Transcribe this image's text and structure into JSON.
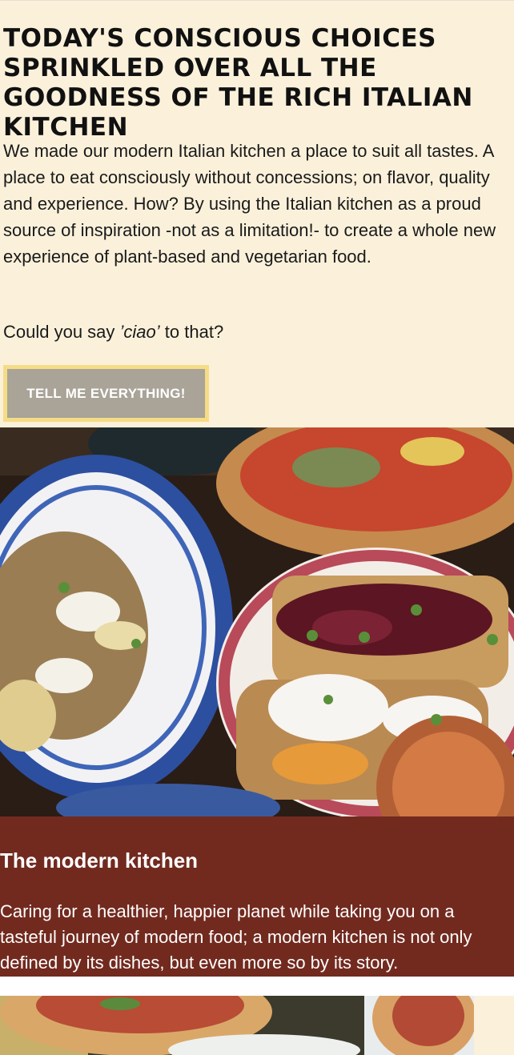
{
  "intro_section": {
    "headline": "TODAY'S CONSCIOUS CHOICES SPRINKLED OVER ALL THE GOODNESS OF THE RICH ITALIAN KITCHEN",
    "paragraph": "We made our modern Italian kitchen a place to suit all tastes. A place to eat consciously without concessions; on flavor, quality and experience. How? By using the Italian kitchen as a proud source of inspiration -not as a limitation!- to create a whole new experience of plant-based and vegetarian food.",
    "question_prefix": "Could you say ",
    "question_emphasis": "’ciao’",
    "question_suffix": " to that?",
    "cta_label": "TELL ME EVERYTHING!"
  },
  "story_section": {
    "title": "The modern kitchen",
    "text": "Caring for a healthier, happier planet while taking you on a tasteful journey of modern food; a modern kitchen is not only defined by its dishes, but even more so by its story."
  },
  "colors": {
    "cream_background": "#fbf1db",
    "button_fill": "#a9a398",
    "button_border": "#f5dc86",
    "story_background": "#722a1f"
  }
}
